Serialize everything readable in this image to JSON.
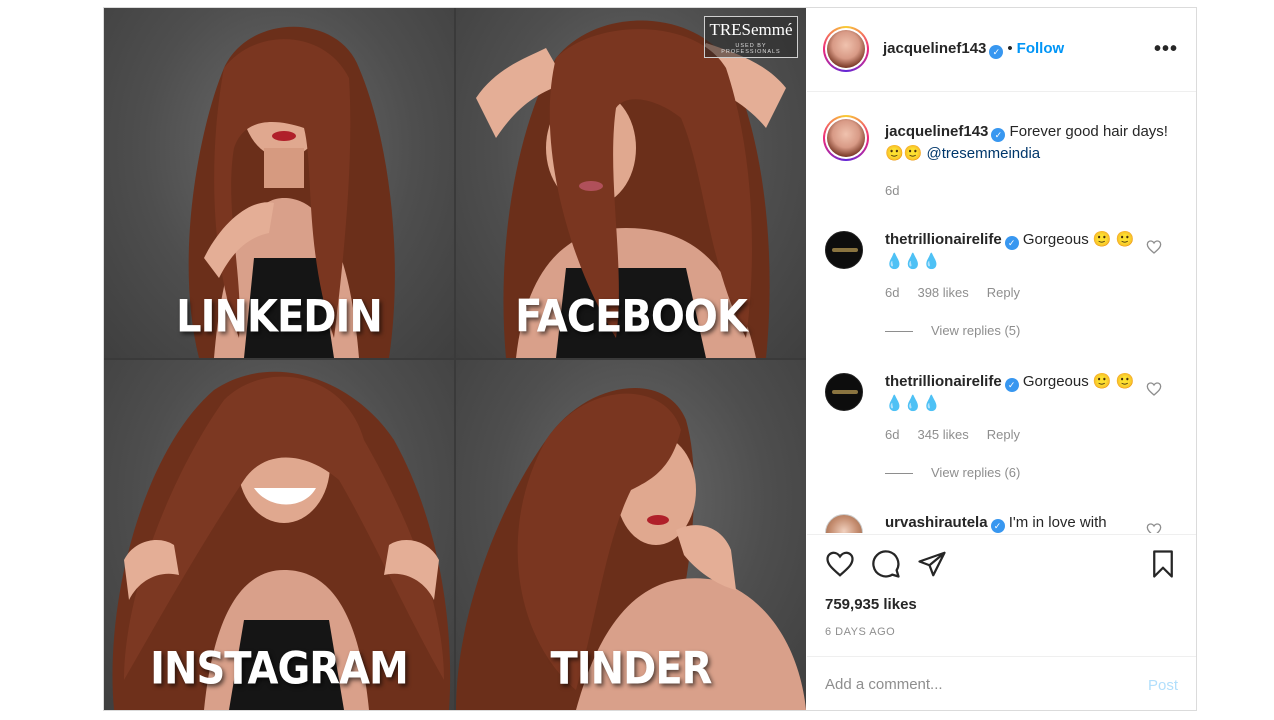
{
  "media": {
    "brand": {
      "name": "TRESemmé",
      "tagline": "USED BY PROFESSIONALS"
    },
    "tiles": [
      {
        "caption": "LINKEDIN"
      },
      {
        "caption": "FACEBOOK"
      },
      {
        "caption": "INSTAGRAM"
      },
      {
        "caption": "TINDER"
      }
    ]
  },
  "header": {
    "username": "jacquelinef143",
    "separator": "•",
    "follow_label": "Follow",
    "more_label": "•••",
    "verified_mark": "✓"
  },
  "caption": {
    "username": "jacquelinef143",
    "text": " Forever good hair days! 🙂🙂 ",
    "mention": "@tresemmeindia",
    "time": "6d"
  },
  "comments": [
    {
      "username": "thetrillionairelife",
      "text": " Gorgeous 🙂 🙂💧💧💧",
      "time": "6d",
      "likes": "398 likes",
      "reply_label": "Reply",
      "view_replies": "View replies (5)"
    },
    {
      "username": "thetrillionairelife",
      "text": " Gorgeous 🙂 🙂💧💧💧",
      "time": "6d",
      "likes": "345 likes",
      "reply_label": "Reply",
      "view_replies": "View replies (6)"
    },
    {
      "username": "urvashirautela",
      "text": " I'm in love with"
    }
  ],
  "actions": {
    "likes": "759,935 likes",
    "date": "6 DAYS AGO"
  },
  "add_comment": {
    "placeholder": "Add a comment...",
    "post_label": "Post"
  }
}
